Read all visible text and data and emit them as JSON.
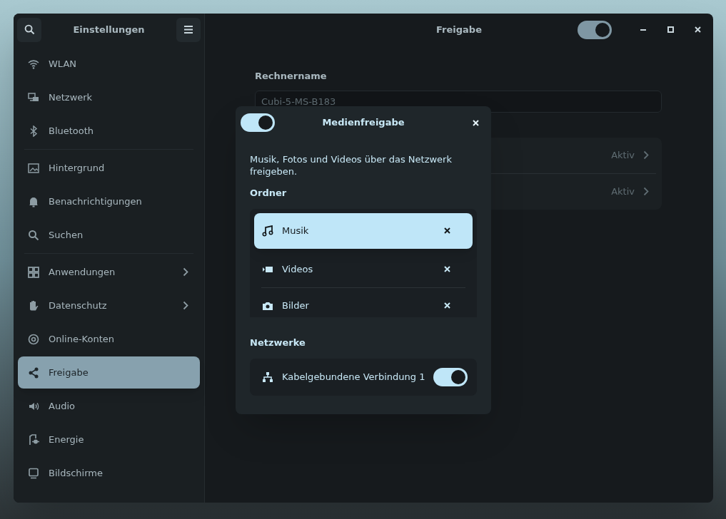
{
  "window": {
    "title": "Freigabe",
    "sharing_on": true
  },
  "sidebar": {
    "title": "Einstellungen",
    "groups": [
      {
        "items": [
          {
            "label": "WLAN",
            "submenu": false,
            "selected": false
          },
          {
            "label": "Netzwerk",
            "submenu": false,
            "selected": false
          },
          {
            "label": "Bluetooth",
            "submenu": false,
            "selected": false
          }
        ]
      },
      {
        "items": [
          {
            "label": "Hintergrund",
            "submenu": false,
            "selected": false
          },
          {
            "label": "Benachrichtigungen",
            "submenu": false,
            "selected": false
          },
          {
            "label": "Suchen",
            "submenu": false,
            "selected": false
          }
        ]
      },
      {
        "items": [
          {
            "label": "Anwendungen",
            "submenu": true,
            "selected": false
          },
          {
            "label": "Datenschutz",
            "submenu": true,
            "selected": false
          },
          {
            "label": "Online-Konten",
            "submenu": false,
            "selected": false
          },
          {
            "label": "Freigabe",
            "submenu": false,
            "selected": true
          },
          {
            "label": "Audio",
            "submenu": false,
            "selected": false
          },
          {
            "label": "Energie",
            "submenu": false,
            "selected": false
          },
          {
            "label": "Bildschirme",
            "submenu": false,
            "selected": false
          }
        ]
      }
    ]
  },
  "main": {
    "hostname": {
      "label": "Rechnername",
      "value": "Cubi-5-MS-B183"
    },
    "services": [
      {
        "status": "Aktiv"
      },
      {
        "status": "Aktiv"
      }
    ]
  },
  "dialog": {
    "enabled": true,
    "title": "Medienfreigabe",
    "description": "Musik, Fotos und Videos über das Netzwerk freigeben.",
    "folders_heading": "Ordner",
    "folders": [
      {
        "name": "Musik",
        "selected": true
      },
      {
        "name": "Videos",
        "selected": false
      },
      {
        "name": "Bilder",
        "selected": false
      }
    ],
    "networks_heading": "Netzwerke",
    "networks": [
      {
        "name": "Kabelgebundene Verbindung 1",
        "on": true
      }
    ]
  }
}
